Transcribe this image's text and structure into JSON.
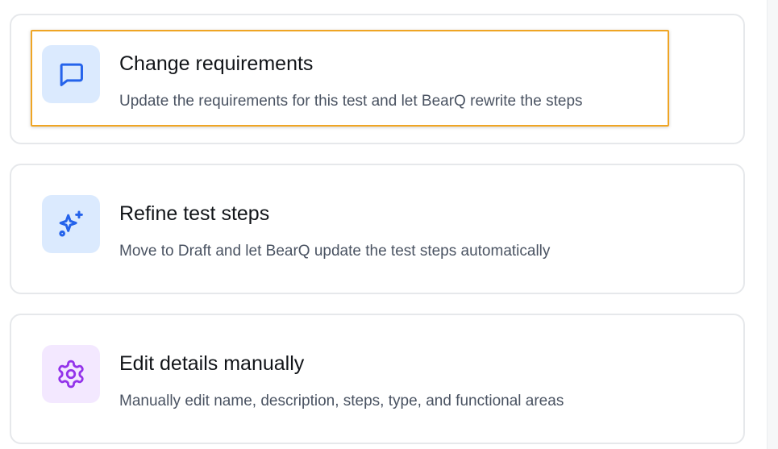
{
  "colors": {
    "accent_blue": "#2563eb",
    "accent_purple": "#9333ea",
    "icon_bg_blue": "#dbeafe",
    "icon_bg_purple": "#f3e8ff",
    "focus_outline": "#efa524",
    "card_border": "#e6e8eb"
  },
  "options": [
    {
      "title": "Change requirements",
      "description": "Update the requirements for this test and let BearQ rewrite the steps",
      "icon": "message-square-icon"
    },
    {
      "title": "Refine test steps",
      "description": "Move to Draft and let BearQ update the test steps automatically",
      "icon": "sparkles-icon"
    },
    {
      "title": "Edit details manually",
      "description": "Manually edit name, description, steps, type, and functional areas",
      "icon": "gear-icon"
    }
  ]
}
